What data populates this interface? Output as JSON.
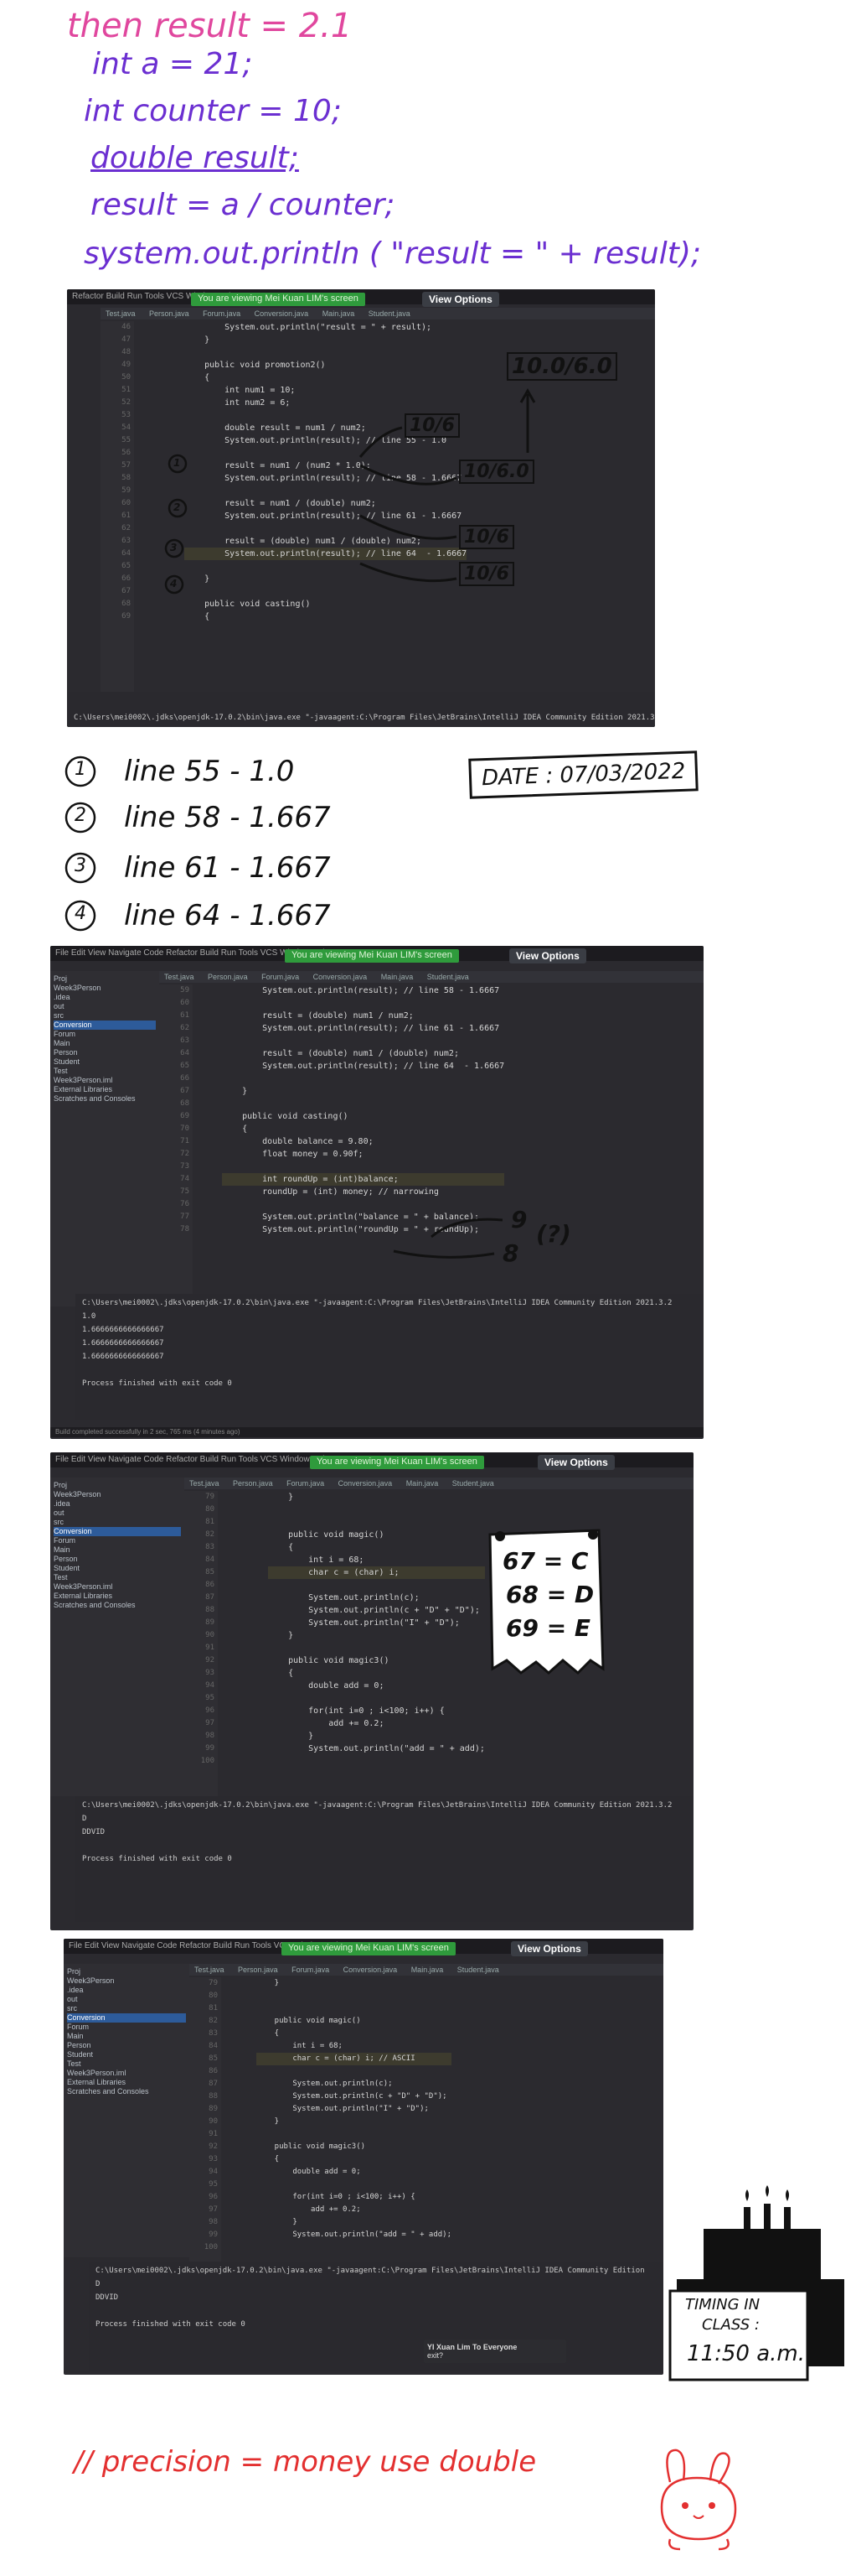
{
  "intro_notes": {
    "heading": "then result = 2.1",
    "lines": [
      "int a = 21;",
      "int counter = 10;",
      "double result;",
      "result = a / counter;",
      "system.out.println ( \"result = \" + result);"
    ]
  },
  "common": {
    "viewing_banner": "You are viewing Mei Kuan LIM's screen",
    "view_options": "View Options",
    "tabs": [
      "Test.java",
      "Person.java",
      "Forum.java",
      "Conversion.java",
      "Main.java",
      "Student.java"
    ]
  },
  "shot1": {
    "line_numbers": [
      "46",
      "47",
      "48",
      "49",
      "50",
      "51",
      "52",
      "53",
      "54",
      "55",
      "56",
      "57",
      "58",
      "59",
      "60",
      "61",
      "62",
      "63",
      "64",
      "65",
      "66",
      "67",
      "68",
      "69"
    ],
    "code": [
      "        System.out.println(\"result = \" + result);",
      "    }",
      "",
      "    public void promotion2()",
      "    {",
      "        int num1 = 10;",
      "        int num2 = 6;",
      "",
      "        double result = num1 / num2;",
      "        System.out.println(result); // line 55 - 1.0",
      "",
      "        result = num1 / (num2 * 1.0);",
      "        System.out.println(result); // line 58 - 1.6667",
      "",
      "        result = num1 / (double) num2;",
      "        System.out.println(result); // line 61 - 1.6667",
      "",
      "        result = (double) num1 / (double) num2;",
      "        System.out.println(result); // line 64  - 1.6667",
      "",
      "    }",
      "",
      "    public void casting()",
      "    {"
    ],
    "console_cmd": "C:\\Users\\mei0002\\.jdks\\openjdk-17.0.2\\bin\\java.exe \"-javaagent:C:\\Program Files\\JetBrains\\IntelliJ IDEA Community Edition 2021.3.2",
    "annotations": {
      "top": "10.0/6.0",
      "a1": "10/6",
      "a2": "10/6.0",
      "a3": "10/6",
      "a4": "10/6",
      "c1": "1",
      "c2": "2",
      "c3": "3",
      "c4": "4"
    }
  },
  "summary": {
    "items": [
      {
        "num": "1",
        "text": "line 55 - 1.0"
      },
      {
        "num": "2",
        "text": "line 58 - 1.667"
      },
      {
        "num": "3",
        "text": "line 61 - 1.667"
      },
      {
        "num": "4",
        "text": "line 64 - 1.667"
      }
    ],
    "date": "DATE : 07/03/2022"
  },
  "shot2": {
    "tree": [
      "Proj",
      "Week3Person",
      ".idea",
      "out",
      "src",
      "Conversion",
      "Forum",
      "Main",
      "Person",
      "Student",
      "Test",
      "Week3Person.iml",
      "External Libraries",
      "Scratches and Consoles"
    ],
    "line_numbers": [
      "59",
      "60",
      "61",
      "62",
      "63",
      "64",
      "65",
      "66",
      "67",
      "68",
      "69",
      "70",
      "71",
      "72",
      "73",
      "74",
      "75",
      "76",
      "77",
      "78"
    ],
    "code": [
      "        System.out.println(result); // line 58 - 1.6667",
      "",
      "        result = (double) num1 / num2;",
      "        System.out.println(result); // line 61 - 1.6667",
      "",
      "        result = (double) num1 / (double) num2;",
      "        System.out.println(result); // line 64  - 1.6667",
      "",
      "    }",
      "",
      "    public void casting()",
      "    {",
      "        double balance = 9.80;",
      "        float money = 0.90f;",
      "",
      "        int roundUp = (int)balance;",
      "        roundUp = (int) money; // narrowing",
      "",
      "        System.out.println(\"balance = \" + balance);",
      "        System.out.println(\"roundUp = \" + roundUp);"
    ],
    "console": [
      "C:\\Users\\mei0002\\.jdks\\openjdk-17.0.2\\bin\\java.exe \"-javaagent:C:\\Program Files\\JetBrains\\IntelliJ IDEA Community Edition 2021.3.2",
      "1.0",
      "1.6666666666666667",
      "1.6666666666666667",
      "1.6666666666666667",
      "",
      "Process finished with exit code 0"
    ],
    "annotations": {
      "nine": "9",
      "eight": "8",
      "q": "(?)"
    },
    "status": "Build completed successfully in 2 sec, 765 ms (4 minutes ago)"
  },
  "shot3": {
    "line_numbers": [
      "79",
      "80",
      "81",
      "82",
      "83",
      "84",
      "85",
      "86",
      "87",
      "88",
      "89",
      "90",
      "91",
      "92",
      "93",
      "94",
      "95",
      "96",
      "97",
      "98",
      "99",
      "100"
    ],
    "code": [
      "    }",
      "",
      "",
      "    public void magic()",
      "    {",
      "        int i = 68;",
      "        char c = (char) i;",
      "",
      "        System.out.println(c);",
      "        System.out.println(c + \"D\" + \"D\");",
      "        System.out.println(\"I\" + \"D\");",
      "    }",
      "",
      "    public void magic3()",
      "    {",
      "        double add = 0;",
      "",
      "        for(int i=0 ; i<100; i++) {",
      "            add += 0.2;",
      "        }",
      "        System.out.println(\"add = \" + add);",
      ""
    ],
    "console": [
      "C:\\Users\\mei0002\\.jdks\\openjdk-17.0.2\\bin\\java.exe \"-javaagent:C:\\Program Files\\JetBrains\\IntelliJ IDEA Community Edition 2021.3.2",
      "D",
      "DDVID",
      "",
      "Process finished with exit code 0"
    ],
    "note": [
      "67 = C",
      "68 = D",
      "69 = E"
    ]
  },
  "shot4": {
    "line_numbers": [
      "79",
      "80",
      "81",
      "82",
      "83",
      "84",
      "85",
      "86",
      "87",
      "88",
      "89",
      "90",
      "91",
      "92",
      "93",
      "94",
      "95",
      "96",
      "97",
      "98",
      "99",
      "100"
    ],
    "code": [
      "    }",
      "",
      "",
      "    public void magic()",
      "    {",
      "        int i = 68;",
      "        char c = (char) i; // ASCII",
      "",
      "        System.out.println(c);",
      "        System.out.println(c + \"D\" + \"D\");",
      "        System.out.println(\"I\" + \"D\");",
      "    }",
      "",
      "    public void magic3()",
      "    {",
      "        double add = 0;",
      "",
      "        for(int i=0 ; i<100; i++) {",
      "            add += 0.2;",
      "        }",
      "        System.out.println(\"add = \" + add);",
      ""
    ],
    "console": [
      "C:\\Users\\mei0002\\.jdks\\openjdk-17.0.2\\bin\\java.exe \"-javaagent:C:\\Program Files\\JetBrains\\IntelliJ IDEA Community Edition",
      "D",
      "DDVID",
      "",
      "Process finished with exit code 0"
    ],
    "notification_title": "YI Xuan Lim To Everyone",
    "notification_body": "exit?",
    "cake_note": [
      "TIMING IN",
      "CLASS :",
      "11:50 a.m."
    ]
  },
  "footer": {
    "note": "// precision = money use double"
  }
}
